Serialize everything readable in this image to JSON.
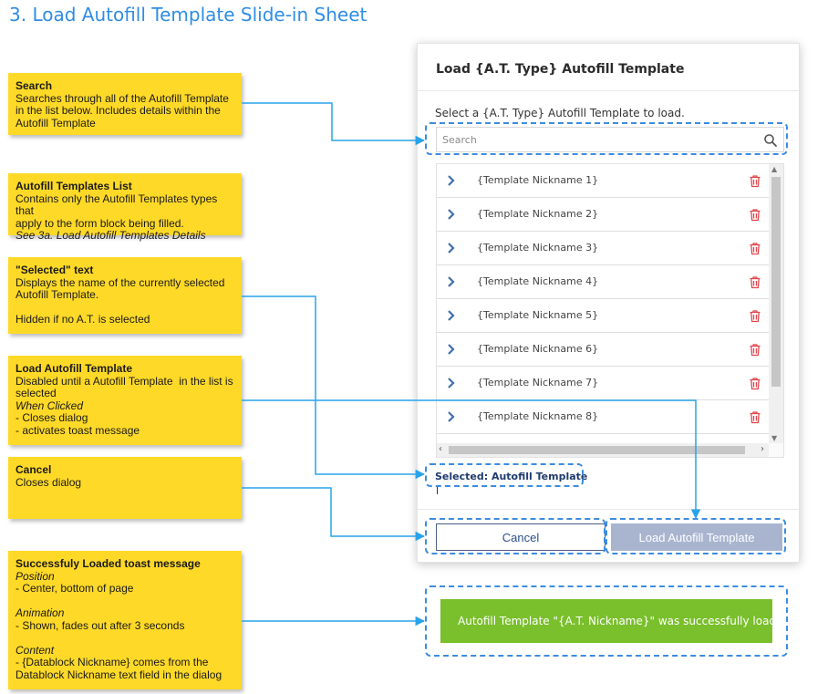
{
  "page": {
    "title": "3. Load Autofill Template Slide-in Sheet"
  },
  "notes": {
    "search": {
      "title": "Search",
      "lines": [
        "Searches through all of the Autofill Template",
        "in the list below. Includes details within the",
        "Autofill Template"
      ]
    },
    "list": {
      "title": "Autofill Templates List",
      "lines": [
        "Contains only the Autofill Templates types that",
        "apply to the form block being filled."
      ],
      "italic": "See 3a. Load Autofill Templates Details"
    },
    "selected": {
      "title": "\"Selected\" text",
      "lines": [
        "Displays the name of the currently selected",
        "Autofill Template.",
        "",
        "Hidden if no A.T. is selected"
      ]
    },
    "load": {
      "title": "Load Autofill Template",
      "lines": [
        "Disabled until a Autofill Template  in the list is",
        "selected"
      ],
      "italic": "When Clicked",
      "lines2": [
        "- Closes dialog",
        "- activates toast message"
      ]
    },
    "cancel": {
      "title": "Cancel",
      "lines": [
        "Closes dialog"
      ]
    },
    "toast": {
      "title": "Successfuly Loaded toast message",
      "position_label": "Position",
      "position_lines": [
        "- Center, bottom of page"
      ],
      "animation_label": "Animation",
      "animation_lines": [
        "- Shown, fades out after 3 seconds"
      ],
      "content_label": "Content",
      "content_lines": [
        "- {Datablock Nickname} comes from the",
        "Datablock Nickname text field in the dialog"
      ]
    }
  },
  "dialog": {
    "title": "Load {A.T. Type} Autofill Template",
    "instruction": "Select a {A.T. Type} Autofill Template to load.",
    "search": {
      "placeholder": "Search",
      "value": ""
    },
    "items": [
      {
        "label": "{Template Nickname 1}"
      },
      {
        "label": "{Template Nickname 2}"
      },
      {
        "label": "{Template Nickname 3}"
      },
      {
        "label": "{Template Nickname 4}"
      },
      {
        "label": "{Template Nickname 5}"
      },
      {
        "label": "{Template Nickname 6}"
      },
      {
        "label": "{Template Nickname 7}"
      },
      {
        "label": "{Template Nickname 8}"
      }
    ],
    "selected_text": "Selected: Autofill Template",
    "cancel_label": "Cancel",
    "load_label": "Load Autofill Template"
  },
  "toast": {
    "message": "Autofill Template \"{A.T. Nickname}\" was successfully loaded"
  },
  "colors": {
    "accent": "#2f8de4",
    "note_bg": "#ffd927",
    "connector": "#29a3ea",
    "highlight": "#3d8ce0",
    "primary_disabled": "#a9b5cf",
    "cancel_border": "#4b5f86",
    "trash": "#e0464c",
    "chevron": "#3f6fb0",
    "toast_bg": "#7abf2c"
  },
  "icons": {
    "search": "search-icon",
    "chevron": "chevron-right-icon",
    "delete": "trash-icon"
  }
}
